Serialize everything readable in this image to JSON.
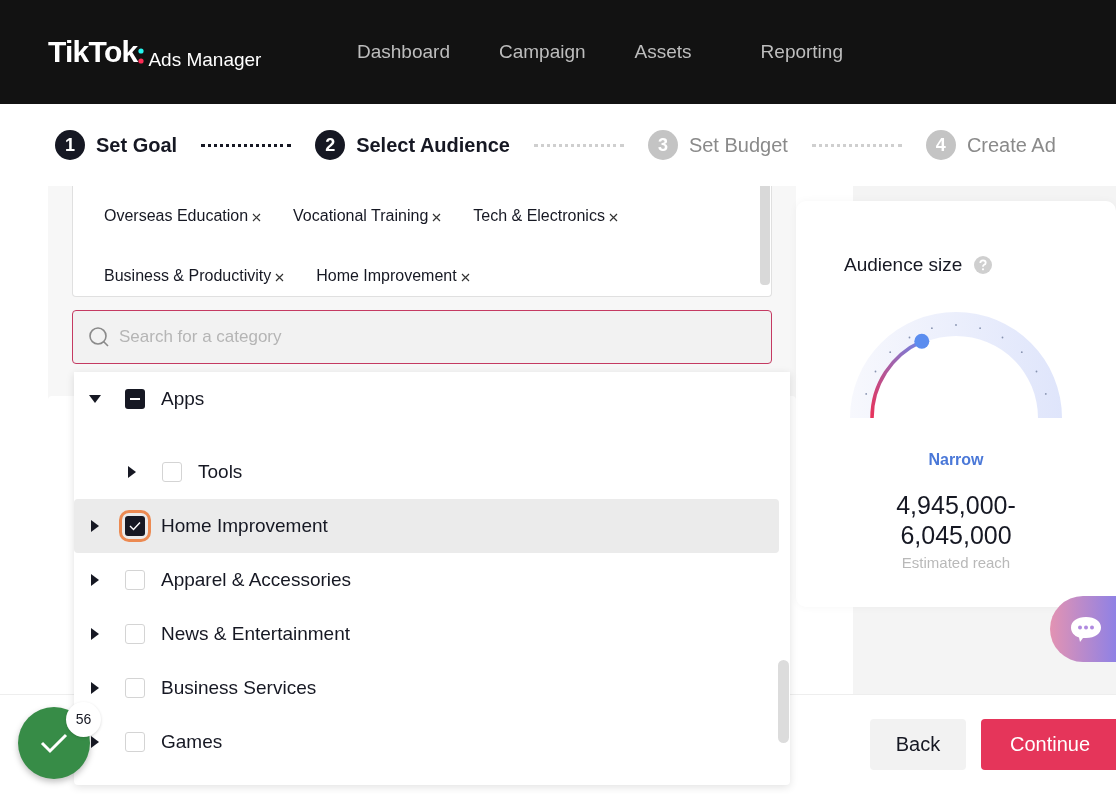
{
  "header": {
    "logo": "TikTok",
    "product": "Ads Manager",
    "nav": [
      {
        "label": "Dashboard",
        "selected": false
      },
      {
        "label": "Campaign",
        "selected": false
      },
      {
        "label": "Assets",
        "selected": false
      },
      {
        "label": "Reporting",
        "selected": false
      }
    ]
  },
  "steps": [
    {
      "number": "1",
      "label": "Set Goal",
      "active": true
    },
    {
      "number": "2",
      "label": "Select Audience",
      "active": true
    },
    {
      "number": "3",
      "label": "Set Budget",
      "active": false
    },
    {
      "number": "4",
      "label": "Create Ad",
      "active": false
    }
  ],
  "selected_tags": [
    "Overseas Education",
    "Vocational Training",
    "Tech & Electronics",
    "Business & Productivity",
    "Home Improvement"
  ],
  "search": {
    "placeholder": "Search for a category"
  },
  "categories": [
    {
      "label": "Apps",
      "expanded": true,
      "checked": false,
      "partial": true,
      "selected": false,
      "focused": false,
      "children": [
        {
          "label": "Tools",
          "expanded": false,
          "checked": false,
          "partial": false,
          "selected": false,
          "focused": false
        }
      ]
    },
    {
      "label": "Home Improvement",
      "expanded": false,
      "checked": true,
      "partial": false,
      "selected": true,
      "focused": true
    },
    {
      "label": "Apparel & Accessories",
      "expanded": false,
      "checked": false,
      "partial": false,
      "selected": false,
      "focused": false
    },
    {
      "label": "News & Entertainment",
      "expanded": false,
      "checked": false,
      "partial": false,
      "selected": false,
      "focused": false
    },
    {
      "label": "Business Services",
      "expanded": false,
      "checked": false,
      "partial": false,
      "selected": false,
      "focused": false
    },
    {
      "label": "Games",
      "expanded": false,
      "checked": false,
      "partial": false,
      "selected": false,
      "focused": false
    }
  ],
  "audience": {
    "title": "Audience size",
    "level": 0.34,
    "rating": "Narrow",
    "reach": "4,945,000-\n6,045,000",
    "reach_label": "Estimated reach"
  },
  "task_badge": {
    "count": "56"
  },
  "buttons": [
    {
      "label": "Back",
      "kind": "secondary"
    },
    {
      "label": "Continue",
      "kind": "primary"
    }
  ]
}
